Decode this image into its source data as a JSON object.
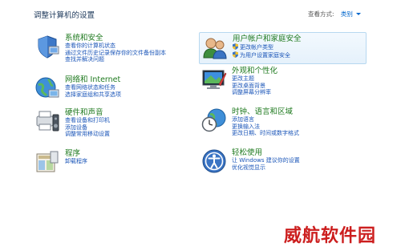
{
  "header": {
    "title": "调整计算机的设置",
    "view_by_label": "查看方式:",
    "view_by_value": "类别"
  },
  "categories": [
    {
      "id": "system-security",
      "icon": "system-security-icon",
      "title": "系统和安全",
      "links": [
        "查看你的计算机状态",
        "通过文件历史记录保存你的文件备份副本",
        "查找并解决问题"
      ]
    },
    {
      "id": "network-internet",
      "icon": "network-icon",
      "title": "网络和 Internet",
      "links": [
        "查看网络状态和任务",
        "选择家庭组和共享选项"
      ]
    },
    {
      "id": "hardware-sound",
      "icon": "hardware-sound-icon",
      "title": "硬件和声音",
      "links": [
        "查看设备和打印机",
        "添加设备",
        "调整常用移动设置"
      ]
    },
    {
      "id": "programs",
      "icon": "programs-icon",
      "title": "程序",
      "links": [
        "卸载程序"
      ]
    },
    {
      "id": "user-accounts",
      "icon": "user-accounts-icon",
      "title": "用户帐户和家庭安全",
      "links": [
        "更改帐户类型",
        "为用户设置家庭安全"
      ]
    },
    {
      "id": "appearance",
      "icon": "appearance-icon",
      "title": "外观和个性化",
      "links": [
        "更改主题",
        "更改桌面背景",
        "调整屏幕分辨率"
      ]
    },
    {
      "id": "clock-language",
      "icon": "clock-language-icon",
      "title": "时钟、语言和区域",
      "links": [
        "添加语言",
        "更换输入法",
        "更改日期、时间或数字格式"
      ]
    },
    {
      "id": "ease-of-access",
      "icon": "ease-of-access-icon",
      "title": "轻松使用",
      "links": [
        "让 Windows 建议你的设置",
        "优化视觉显示"
      ]
    }
  ],
  "watermark": "威航软件园",
  "colors": {
    "category_title": "#1f7a1f",
    "link": "#1a55b8",
    "highlight_bg": "#e5f1fb",
    "highlight_border": "#b7d8f0",
    "watermark": "#cc1e1e"
  }
}
